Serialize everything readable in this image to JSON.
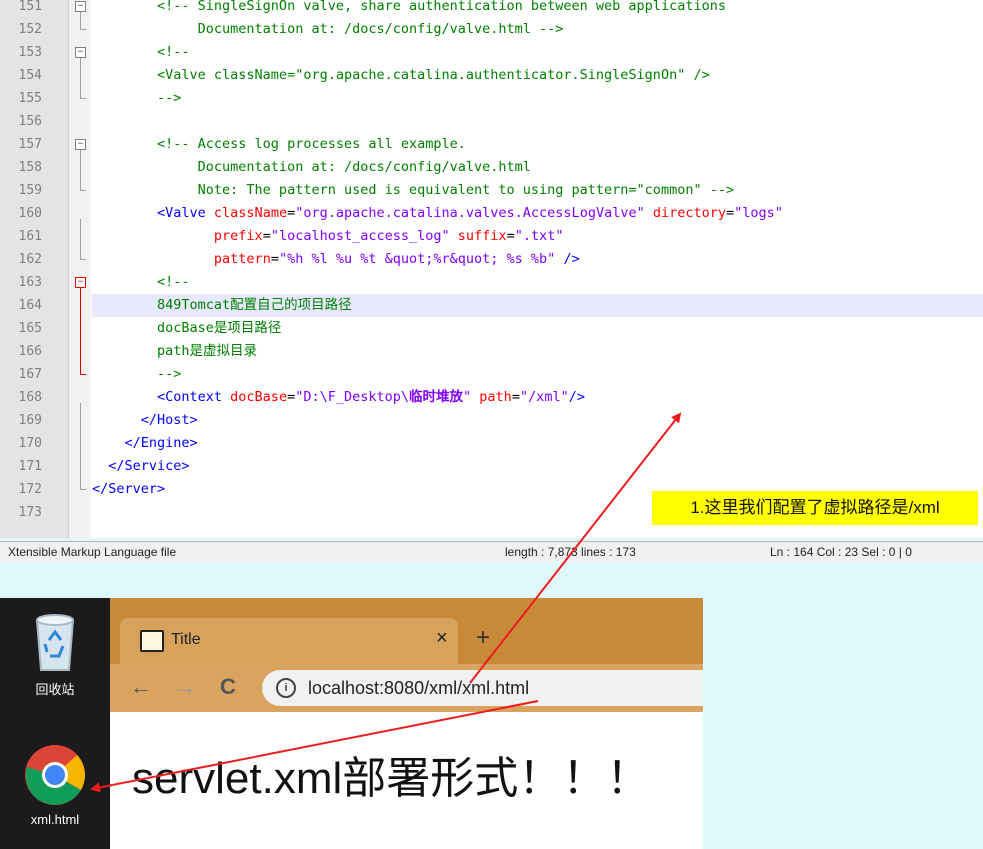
{
  "editor": {
    "lines": [
      {
        "n": "151",
        "parts": [
          [
            "cm",
            "        <!-- SingleSignOn valve, share authentication between web applications"
          ]
        ]
      },
      {
        "n": "152",
        "parts": [
          [
            "cm",
            "             Documentation at: /docs/config/valve.html -->"
          ]
        ]
      },
      {
        "n": "153",
        "parts": [
          [
            "cm",
            "        <!--"
          ]
        ]
      },
      {
        "n": "154",
        "parts": [
          [
            "cm",
            "        <Valve className=\"org.apache.catalina.authenticator.SingleSignOn\" />"
          ]
        ]
      },
      {
        "n": "155",
        "parts": [
          [
            "cm",
            "        -->"
          ]
        ]
      },
      {
        "n": "156",
        "parts": []
      },
      {
        "n": "157",
        "parts": [
          [
            "cm",
            "        <!-- Access log processes all example."
          ]
        ]
      },
      {
        "n": "158",
        "parts": [
          [
            "cm",
            "             Documentation at: /docs/config/valve.html"
          ]
        ]
      },
      {
        "n": "159",
        "parts": [
          [
            "cm",
            "             Note: The pattern used is equivalent to using pattern=\"common\" -->"
          ]
        ]
      },
      {
        "n": "160",
        "parts": [
          [
            "tg",
            "        <Valve "
          ],
          [
            "at",
            "className"
          ],
          [
            "tx",
            "="
          ],
          [
            "vl",
            "\"org.apache.catalina.valves.AccessLogValve\""
          ],
          [
            "tx",
            " "
          ],
          [
            "at",
            "directory"
          ],
          [
            "tx",
            "="
          ],
          [
            "vl",
            "\"logs\""
          ]
        ]
      },
      {
        "n": "161",
        "parts": [
          [
            "tg",
            "               "
          ],
          [
            "at",
            "prefix"
          ],
          [
            "tx",
            "="
          ],
          [
            "vl",
            "\"localhost_access_log\""
          ],
          [
            "tx",
            " "
          ],
          [
            "at",
            "suffix"
          ],
          [
            "tx",
            "="
          ],
          [
            "vl",
            "\".txt\""
          ]
        ]
      },
      {
        "n": "162",
        "parts": [
          [
            "tg",
            "               "
          ],
          [
            "at",
            "pattern"
          ],
          [
            "tx",
            "="
          ],
          [
            "vl",
            "\"%h %l %u %t &quot;%r&quot; %s %b\""
          ],
          [
            "tg",
            " />"
          ]
        ]
      },
      {
        "n": "163",
        "parts": [
          [
            "cm",
            "        <!--"
          ]
        ]
      },
      {
        "n": "164",
        "parts": [
          [
            "cm",
            "        849Tomcat配置自己的项目路径"
          ]
        ]
      },
      {
        "n": "165",
        "parts": [
          [
            "cm",
            "        docBase是项目路径"
          ]
        ]
      },
      {
        "n": "166",
        "parts": [
          [
            "cm",
            "        path是虚拟目录"
          ]
        ]
      },
      {
        "n": "167",
        "parts": [
          [
            "cm",
            "        -->"
          ]
        ]
      },
      {
        "n": "168",
        "parts": [
          [
            "tg",
            "        <Context "
          ],
          [
            "at",
            "docBase"
          ],
          [
            "tx",
            "="
          ],
          [
            "vl",
            "\"D:\\F_Desktop\\"
          ],
          [
            "vb",
            "临时堆放"
          ],
          [
            "vl",
            "\""
          ],
          [
            "tx",
            " "
          ],
          [
            "at",
            "path"
          ],
          [
            "tx",
            "="
          ],
          [
            "vl",
            "\"/xml\""
          ],
          [
            "tg",
            "/>"
          ]
        ]
      },
      {
        "n": "169",
        "parts": [
          [
            "tg",
            "      </Host>"
          ]
        ]
      },
      {
        "n": "170",
        "parts": [
          [
            "tg",
            "    </Engine>"
          ]
        ]
      },
      {
        "n": "171",
        "parts": [
          [
            "tg",
            "  </Service>"
          ]
        ]
      },
      {
        "n": "172",
        "parts": [
          [
            "tg",
            "</Server>"
          ]
        ]
      },
      {
        "n": "173",
        "parts": []
      }
    ],
    "highlight_line_index": 13
  },
  "statusbar": {
    "type": "Xtensible Markup Language file",
    "length": "length : 7,873    lines : 173",
    "position": "Ln : 164    Col : 23    Sel : 0 | 0"
  },
  "desktop": {
    "recycle_bin_label": "回收站",
    "chrome_file_label": "xml.html"
  },
  "browser": {
    "tab_title": "Title",
    "tab_close": "×",
    "new_tab": "+",
    "back": "←",
    "forward": "→",
    "reload": "C",
    "info": "i",
    "url": "localhost:8080/xml/xml.html",
    "page_heading": "servlet.xml部署形式！！！"
  },
  "annotation": {
    "note": "1.这里我们配置了虚拟路径是/xml",
    "arrow_color": "#ee1c1c"
  }
}
